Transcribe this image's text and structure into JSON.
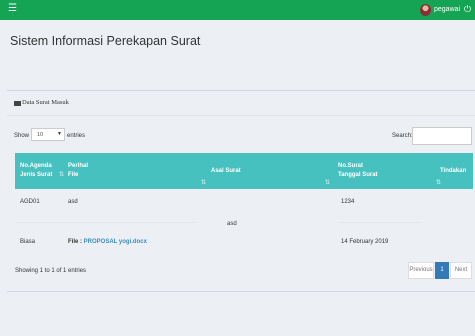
{
  "header": {
    "menu_icon": "☰",
    "user_name": "pegawai",
    "power_icon": "⏻"
  },
  "page": {
    "title": "Sistem Informasi Perekapan Surat"
  },
  "box": {
    "title": "Data Surat Masuk"
  },
  "table_controls": {
    "show_label": "Show",
    "length_value": "10",
    "entries_label": "entries",
    "search_label": "Search:"
  },
  "table": {
    "columns": [
      {
        "line1": "No.Agenda",
        "line2": "Jenis Surat"
      },
      {
        "line1": "Perihal",
        "line2": "File"
      },
      {
        "line1": "Asal Surat",
        "line2": ""
      },
      {
        "line1": "No.Surat",
        "line2": "Tanggal Surat"
      },
      {
        "line1": "Tindakan",
        "line2": ""
      }
    ],
    "rows": [
      {
        "no_agenda": "AGD01",
        "jenis_surat": "Biasa",
        "perihal": "asd",
        "file_prefix": "File : ",
        "file_name": "PROPOSAL yogi.docx",
        "asal_surat": "asd",
        "no_surat": "1234",
        "tanggal_surat": "14 February 2019",
        "tindakan": ""
      }
    ]
  },
  "footer": {
    "info": "Showing 1 to 1 of 1 entries",
    "previous": "Previous",
    "current_page": "1",
    "next": "Next"
  }
}
